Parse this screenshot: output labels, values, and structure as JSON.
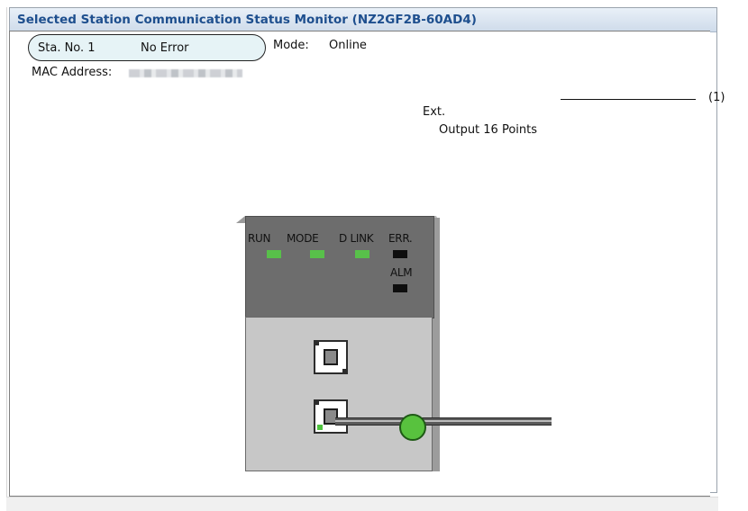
{
  "window": {
    "title": "Selected Station Communication Status Monitor (NZ2GF2B-60AD4)"
  },
  "station": {
    "number_label": "Sta. No. 1",
    "status": "No Error",
    "mode_label": "Mode:",
    "mode_value": "Online",
    "mac_label": "MAC Address:"
  },
  "ext": {
    "label": "Ext.",
    "value": "Output 16 Points",
    "callout": "(1)"
  },
  "module": {
    "leds": {
      "run": {
        "label": "RUN",
        "state": "on",
        "color": "#58c04a"
      },
      "mode": {
        "label": "MODE",
        "state": "on",
        "color": "#58c04a"
      },
      "d_link": {
        "label": "D LINK",
        "state": "on",
        "color": "#58c04a"
      },
      "err": {
        "label": "ERR.",
        "state": "off",
        "color": "#0e0e0e"
      },
      "alm": {
        "label": "ALM",
        "state": "off",
        "color": "#0e0e0e"
      }
    },
    "ports": [
      {
        "name": "port-1",
        "connected": false
      },
      {
        "name": "port-2",
        "connected": true,
        "link_indicator": "green"
      }
    ],
    "connection_indicator_color": "#58c23e"
  },
  "colors": {
    "title_text": "#1e4f8e",
    "station_box_bg": "#e6f3f6"
  }
}
